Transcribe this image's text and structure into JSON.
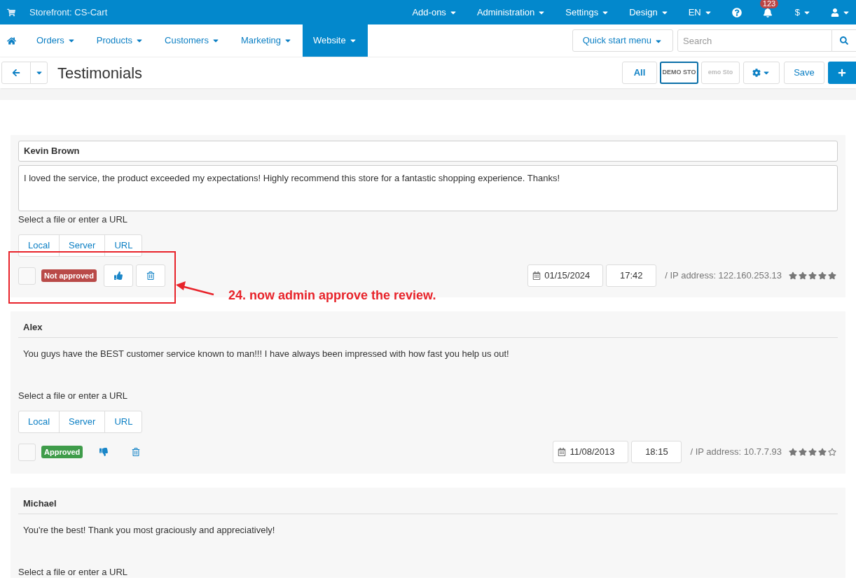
{
  "topbar": {
    "storefront": "Storefront: CS-Cart",
    "menus": [
      {
        "label": "Add-ons"
      },
      {
        "label": "Administration"
      },
      {
        "label": "Settings"
      },
      {
        "label": "Design"
      },
      {
        "label": "EN"
      }
    ],
    "notification_count": "123",
    "currency": "$"
  },
  "nav": {
    "items": [
      {
        "label": "Orders",
        "selected": false
      },
      {
        "label": "Products",
        "selected": false
      },
      {
        "label": "Customers",
        "selected": false
      },
      {
        "label": "Marketing",
        "selected": false
      },
      {
        "label": "Website",
        "selected": true
      }
    ],
    "quick_start": "Quick start menu",
    "search": {
      "placeholder": "Search"
    }
  },
  "toolbar": {
    "title": "Testimonials",
    "all_button": "All",
    "stores": [
      {
        "label": "DEMO STO",
        "selected": true
      },
      {
        "label": "emo Sto",
        "selected": false
      }
    ],
    "save_button": "Save"
  },
  "reviews": [
    {
      "name": "Kevin Brown",
      "message": "I loved the service, the product exceeded my expectations! Highly recommend this store for a fantastic shopping experience. Thanks!",
      "hovered": true,
      "file_label": "Select a file or enter a URL",
      "file_sources": [
        "Local",
        "Server",
        "URL"
      ],
      "checked": false,
      "approved": false,
      "status": "Not approved",
      "date": "01/15/2024",
      "time": "17:42",
      "ip": "/ IP address: 122.160.253.13",
      "stars": 5,
      "annotation": "24. now admin approve the review."
    },
    {
      "name": "Alex",
      "message": "You guys have the BEST customer service known to man!!! I have always been impressed with how fast you help us out!",
      "hovered": false,
      "file_label": "Select a file or enter a URL",
      "file_sources": [
        "Local",
        "Server",
        "URL"
      ],
      "checked": false,
      "approved": true,
      "status": "Approved",
      "date": "11/08/2013",
      "time": "18:15",
      "ip": "/ IP address: 10.7.7.93",
      "stars": 4
    },
    {
      "name": "Michael",
      "message": "You're the best! Thank you most graciously and appreciatively!",
      "hovered": false,
      "file_label": "Select a file or enter a URL"
    }
  ]
}
